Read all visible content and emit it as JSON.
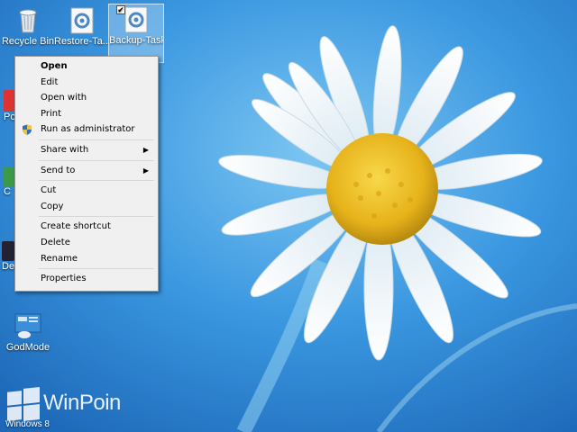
{
  "desktop": {
    "icons": [
      {
        "label": "Recycle Bin",
        "icon": "recycle-bin-icon"
      },
      {
        "label": "Restore-Ta...",
        "icon": "task-gear-icon"
      },
      {
        "label": "Backup-Task",
        "icon": "task-gear-icon",
        "selected": true,
        "checked": true
      },
      {
        "label": "GodMode",
        "icon": "control-panel-icon"
      }
    ],
    "partial_labels": [
      "Po",
      "C",
      "Dec"
    ]
  },
  "context_menu": {
    "items": [
      {
        "label": "Open",
        "bold": true
      },
      {
        "label": "Edit"
      },
      {
        "label": "Open with"
      },
      {
        "label": "Print"
      },
      {
        "label": "Run as administrator",
        "icon": "uac-shield-icon"
      },
      {
        "label": "Share with",
        "submenu": true
      },
      {
        "label": "Send to",
        "submenu": true
      },
      {
        "label": "Cut"
      },
      {
        "label": "Copy"
      },
      {
        "label": "Create shortcut"
      },
      {
        "label": "Delete"
      },
      {
        "label": "Rename"
      },
      {
        "label": "Properties"
      }
    ],
    "submenu_arrow": "▶"
  },
  "watermark": {
    "brand": "WinPoin",
    "os": "Windows 8"
  },
  "colors": {
    "sky": "#2f8fdc",
    "petal": "#ffffff",
    "flower_center": "#f0c419",
    "menu_bg": "#f0f0f0"
  }
}
